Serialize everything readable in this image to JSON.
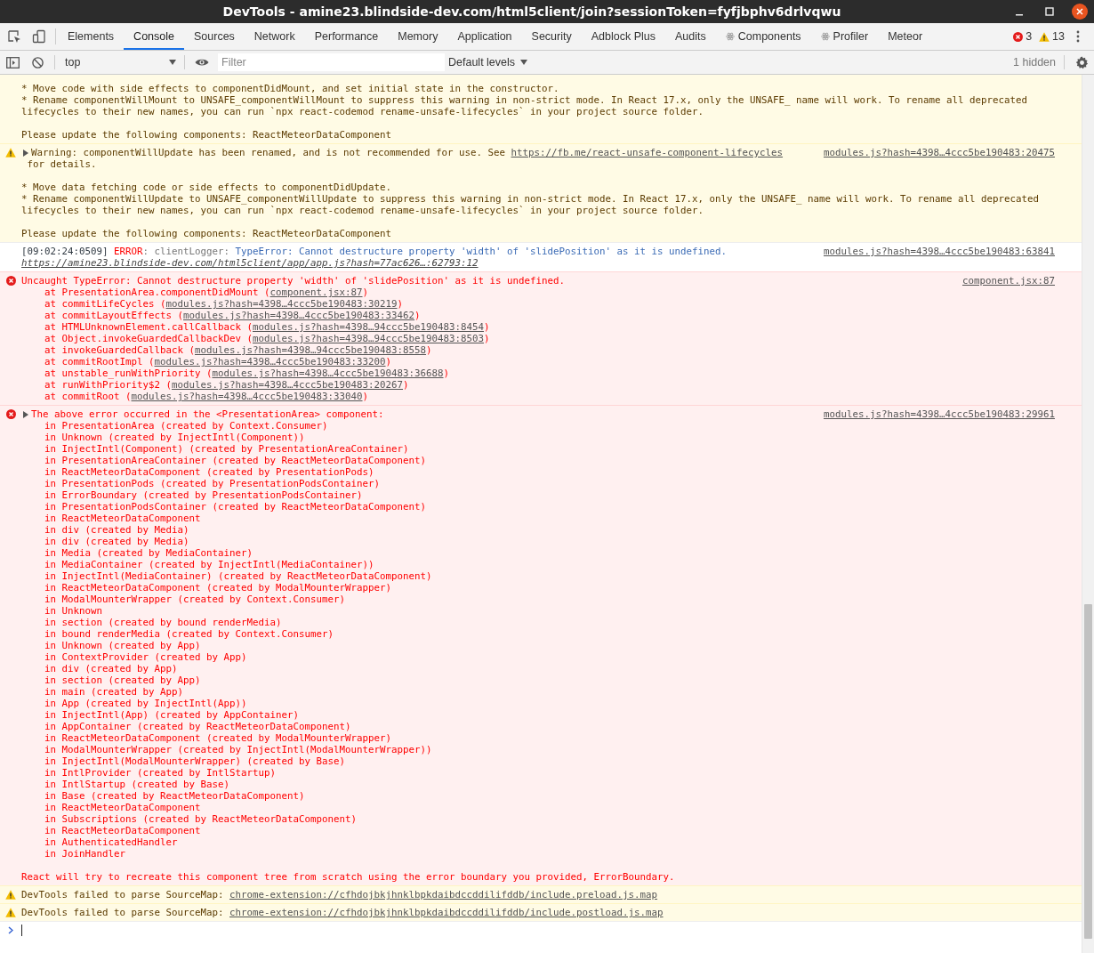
{
  "window": {
    "title": "DevTools - amine23.blindside-dev.com/html5client/join?sessionToken=fyfjbphv6drlvqwu"
  },
  "tabs": [
    {
      "label": "Elements",
      "selected": false,
      "kind": "panel"
    },
    {
      "label": "Console",
      "selected": true,
      "kind": "panel"
    },
    {
      "label": "Sources",
      "selected": false,
      "kind": "panel"
    },
    {
      "label": "Network",
      "selected": false,
      "kind": "panel"
    },
    {
      "label": "Performance",
      "selected": false,
      "kind": "panel"
    },
    {
      "label": "Memory",
      "selected": false,
      "kind": "panel"
    },
    {
      "label": "Application",
      "selected": false,
      "kind": "panel"
    },
    {
      "label": "Security",
      "selected": false,
      "kind": "panel"
    },
    {
      "label": "Adblock Plus",
      "selected": false,
      "kind": "panel"
    },
    {
      "label": "Audits",
      "selected": false,
      "kind": "panel"
    },
    {
      "label": "Components",
      "selected": false,
      "kind": "react"
    },
    {
      "label": "Profiler",
      "selected": false,
      "kind": "react"
    },
    {
      "label": "Meteor",
      "selected": false,
      "kind": "panel"
    }
  ],
  "counts": {
    "errors": "3",
    "warnings": "13"
  },
  "toolbar": {
    "context": "top",
    "filter": {
      "placeholder": "Filter"
    },
    "levels": "Default levels",
    "hidden": "1 hidden"
  },
  "messages": [
    {
      "kind": "warning",
      "continued": true,
      "expandable": false,
      "blocks": [
        {
          "kind": "text",
          "lines": [
            "* Move code with side effects to componentDidMount, and set initial state in the constructor.",
            "* Rename componentWillMount to UNSAFE_componentWillMount to suppress this warning in non-strict mode. In React 17.x, only the UNSAFE_ name will work. To rename all deprecated",
            "lifecycles to their new names, you can run `npx react-codemod rename-unsafe-lifecycles` in your project source folder."
          ]
        },
        {
          "kind": "blank"
        },
        {
          "kind": "text",
          "lines": [
            "Please update the following components: ReactMeteorDataComponent"
          ]
        }
      ]
    },
    {
      "kind": "warning",
      "continued": false,
      "expandable": true,
      "source": "modules.js?hash=4398…4ccc5be190483:20475",
      "blocks": [
        {
          "kind": "text",
          "lines": [
            [
              {
                "text": "Warning: componentWillUpdate has been renamed, and is not recommended for use. See ",
                "kind": "text"
              },
              {
                "text": "https://fb.me/react-unsafe-component-lifecycles",
                "kind": "link"
              }
            ],
            " for details."
          ]
        },
        {
          "kind": "blank"
        },
        {
          "kind": "text",
          "lines": [
            "* Move data fetching code or side effects to componentDidUpdate.",
            "* Rename componentWillUpdate to UNSAFE_componentWillUpdate to suppress this warning in non-strict mode. In React 17.x, only the UNSAFE_ name will work. To rename all deprecated",
            "lifecycles to their new names, you can run `npx react-codemod rename-unsafe-lifecycles` in your project source folder."
          ]
        },
        {
          "kind": "blank"
        },
        {
          "kind": "text",
          "lines": [
            "Please update the following components: ReactMeteorDataComponent"
          ]
        }
      ]
    },
    {
      "kind": "log",
      "continued": false,
      "expandable": false,
      "source": "modules.js?hash=4398…4ccc5be190483:63841",
      "blocks": [
        {
          "kind": "text",
          "lines": [
            [
              {
                "text": "[09:02:24:0509] ",
                "kind": "text"
              },
              {
                "text": "ERROR",
                "kind": "tag"
              },
              {
                "text": ": clientLogger: ",
                "kind": "muted"
              },
              {
                "text": "TypeError: Cannot destructure property 'width' of 'slidePosition' as it is undefined.",
                "kind": "info"
              }
            ],
            [
              {
                "text": "https://amine23.blindside-dev.com/html5client/app/app.js?hash=77ac626…:62793:12",
                "kind": "url"
              }
            ]
          ]
        }
      ]
    },
    {
      "kind": "error",
      "continued": false,
      "expandable": false,
      "source": "component.jsx:87",
      "blocks": [
        {
          "kind": "text",
          "lines": [
            "Uncaught TypeError: Cannot destructure property 'width' of 'slidePosition' as it is undefined."
          ]
        },
        {
          "kind": "stack",
          "lines": [
            [
              {
                "text": "at PresentationArea.componentDidMount (",
                "kind": "text"
              },
              {
                "text": "component.jsx:87",
                "kind": "link"
              },
              {
                "text": ")",
                "kind": "text"
              }
            ],
            [
              {
                "text": "at commitLifeCycles (",
                "kind": "text"
              },
              {
                "text": "modules.js?hash=4398…4ccc5be190483:30219",
                "kind": "link"
              },
              {
                "text": ")",
                "kind": "text"
              }
            ],
            [
              {
                "text": "at commitLayoutEffects (",
                "kind": "text"
              },
              {
                "text": "modules.js?hash=4398…4ccc5be190483:33462",
                "kind": "link"
              },
              {
                "text": ")",
                "kind": "text"
              }
            ],
            [
              {
                "text": "at HTMLUnknownElement.callCallback (",
                "kind": "text"
              },
              {
                "text": "modules.js?hash=4398…94ccc5be190483:8454",
                "kind": "link"
              },
              {
                "text": ")",
                "kind": "text"
              }
            ],
            [
              {
                "text": "at Object.invokeGuardedCallbackDev (",
                "kind": "text"
              },
              {
                "text": "modules.js?hash=4398…94ccc5be190483:8503",
                "kind": "link"
              },
              {
                "text": ")",
                "kind": "text"
              }
            ],
            [
              {
                "text": "at invokeGuardedCallback (",
                "kind": "text"
              },
              {
                "text": "modules.js?hash=4398…94ccc5be190483:8558",
                "kind": "link"
              },
              {
                "text": ")",
                "kind": "text"
              }
            ],
            [
              {
                "text": "at commitRootImpl (",
                "kind": "text"
              },
              {
                "text": "modules.js?hash=4398…4ccc5be190483:33200",
                "kind": "link"
              },
              {
                "text": ")",
                "kind": "text"
              }
            ],
            [
              {
                "text": "at unstable_runWithPriority (",
                "kind": "text"
              },
              {
                "text": "modules.js?hash=4398…4ccc5be190483:36688",
                "kind": "link"
              },
              {
                "text": ")",
                "kind": "text"
              }
            ],
            [
              {
                "text": "at runWithPriority$2 (",
                "kind": "text"
              },
              {
                "text": "modules.js?hash=4398…4ccc5be190483:20267",
                "kind": "link"
              },
              {
                "text": ")",
                "kind": "text"
              }
            ],
            [
              {
                "text": "at commitRoot (",
                "kind": "text"
              },
              {
                "text": "modules.js?hash=4398…4ccc5be190483:33040",
                "kind": "link"
              },
              {
                "text": ")",
                "kind": "text"
              }
            ]
          ]
        }
      ]
    },
    {
      "kind": "error",
      "continued": false,
      "expandable": true,
      "source": "modules.js?hash=4398…4ccc5be190483:29961",
      "blocks": [
        {
          "kind": "text",
          "lines": [
            "The above error occurred in the <PresentationArea> component:"
          ]
        },
        {
          "kind": "stack",
          "lines": [
            "in PresentationArea (created by Context.Consumer)",
            "in Unknown (created by InjectIntl(Component))",
            "in InjectIntl(Component) (created by PresentationAreaContainer)",
            "in PresentationAreaContainer (created by ReactMeteorDataComponent)",
            "in ReactMeteorDataComponent (created by PresentationPods)",
            "in PresentationPods (created by PresentationPodsContainer)",
            "in ErrorBoundary (created by PresentationPodsContainer)",
            "in PresentationPodsContainer (created by ReactMeteorDataComponent)",
            "in ReactMeteorDataComponent",
            "in div (created by Media)",
            "in div (created by Media)",
            "in Media (created by MediaContainer)",
            "in MediaContainer (created by InjectIntl(MediaContainer))",
            "in InjectIntl(MediaContainer) (created by ReactMeteorDataComponent)",
            "in ReactMeteorDataComponent (created by ModalMounterWrapper)",
            "in ModalMounterWrapper (created by Context.Consumer)",
            "in Unknown",
            "in section (created by bound renderMedia)",
            "in bound renderMedia (created by Context.Consumer)",
            "in Unknown (created by App)",
            "in ContextProvider (created by App)",
            "in div (created by App)",
            "in section (created by App)",
            "in main (created by App)",
            "in App (created by InjectIntl(App))",
            "in InjectIntl(App) (created by AppContainer)",
            "in AppContainer (created by ReactMeteorDataComponent)",
            "in ReactMeteorDataComponent (created by ModalMounterWrapper)",
            "in ModalMounterWrapper (created by InjectIntl(ModalMounterWrapper))",
            "in InjectIntl(ModalMounterWrapper) (created by Base)",
            "in IntlProvider (created by IntlStartup)",
            "in IntlStartup (created by Base)",
            "in Base (created by ReactMeteorDataComponent)",
            "in ReactMeteorDataComponent",
            "in Subscriptions (created by ReactMeteorDataComponent)",
            "in ReactMeteorDataComponent",
            "in AuthenticatedHandler",
            "in JoinHandler"
          ]
        },
        {
          "kind": "blank"
        },
        {
          "kind": "text",
          "lines": [
            "React will try to recreate this component tree from scratch using the error boundary you provided, ErrorBoundary."
          ]
        }
      ]
    },
    {
      "kind": "warning",
      "continued": false,
      "expandable": false,
      "blocks": [
        {
          "kind": "text",
          "lines": [
            [
              {
                "text": "DevTools failed to parse SourceMap: ",
                "kind": "text"
              },
              {
                "text": "chrome-extension://cfhdojbkjhnklbpkdaibdccddilifddb/include.preload.js.map",
                "kind": "link"
              }
            ]
          ]
        }
      ]
    },
    {
      "kind": "warning",
      "continued": false,
      "expandable": false,
      "blocks": [
        {
          "kind": "text",
          "lines": [
            [
              {
                "text": "DevTools failed to parse SourceMap: ",
                "kind": "text"
              },
              {
                "text": "chrome-extension://cfhdojbkjhnklbpkdaibdccddilifddb/include.postload.js.map",
                "kind": "link"
              }
            ]
          ]
        }
      ]
    }
  ]
}
